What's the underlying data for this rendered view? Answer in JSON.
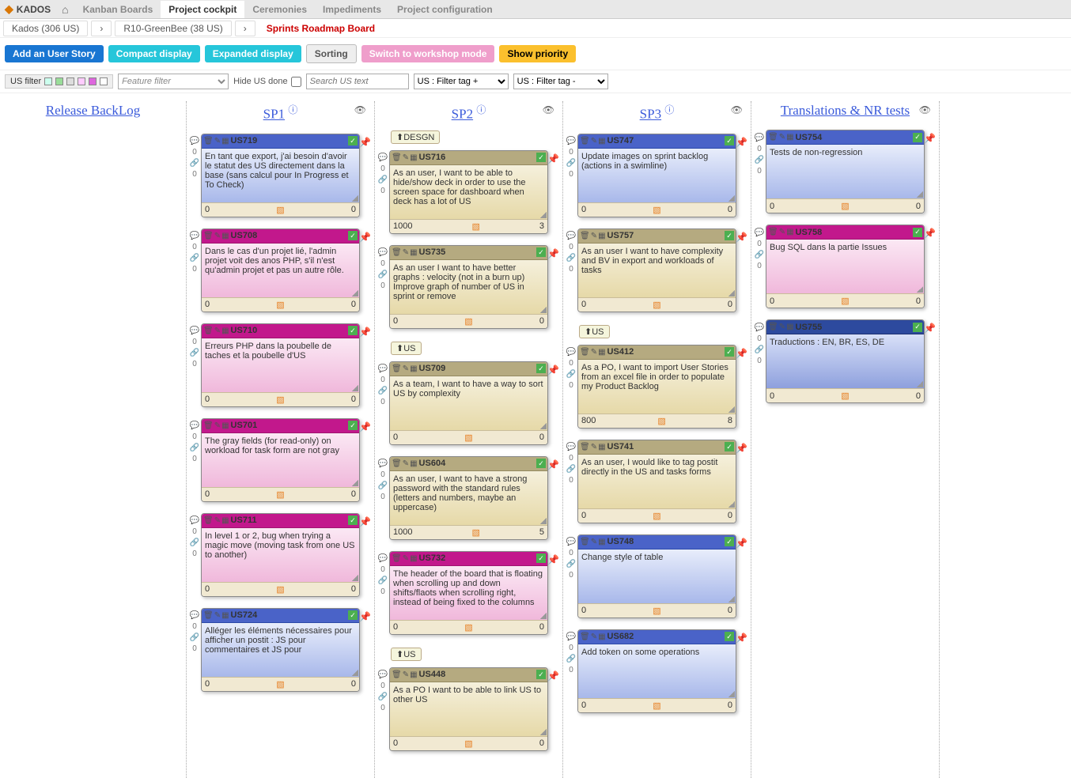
{
  "app": {
    "name": "KADOS"
  },
  "nav": {
    "home": "⌂",
    "items": [
      "Kanban Boards",
      "Project cockpit",
      "Ceremonies",
      "Impediments",
      "Project configuration"
    ],
    "active": 1
  },
  "breadcrumb": {
    "a": "Kados (306 US)",
    "b": "R10-GreenBee (38 US)",
    "c": "Sprints Roadmap Board"
  },
  "toolbar": {
    "add": "Add an User Story",
    "compact": "Compact display",
    "expanded": "Expanded display",
    "sorting": "Sorting",
    "workshop": "Switch to workshop mode",
    "priority": "Show priority"
  },
  "filters": {
    "uslabel": "US filter",
    "feature_ph": "Feature filter",
    "hidedone": "Hide US done",
    "search_ph": "Search US text",
    "tagplus": "US : Filter tag +",
    "tagminus": "US : Filter tag -"
  },
  "columns": {
    "backlog": "Release BackLog",
    "sp1": "SP1",
    "sp2": "SP2",
    "sp3": "SP3",
    "trans": "Translations & NR tests"
  },
  "groups": {
    "desgn": "DESGN",
    "us": "US"
  },
  "cards": {
    "sp1": [
      {
        "id": "US719",
        "txt": "En tant que export, j'ai besoin d'avoir le statut des US directement dans la base (sans calcul pour In Progress et To Check)",
        "l": "0",
        "r": "0",
        "c": "blue"
      },
      {
        "id": "US708",
        "txt": "Dans le cas d'un projet lié, l'admin projet voit des anos PHP, s'il n'est qu'admin projet et pas un autre rôle.",
        "l": "0",
        "r": "0",
        "c": "pink"
      },
      {
        "id": "US710",
        "txt": "Erreurs PHP dans la poubelle de taches et la poubelle d'US",
        "l": "0",
        "r": "0",
        "c": "pink"
      },
      {
        "id": "US701",
        "txt": "The gray fields (for read-only) on workload for task form are not gray",
        "l": "0",
        "r": "0",
        "c": "pink"
      },
      {
        "id": "US711",
        "txt": "In level 1 or 2, bug when trying a magic move (moving task from one US to another)",
        "l": "0",
        "r": "0",
        "c": "pink"
      },
      {
        "id": "US724",
        "txt": "Alléger les éléments nécessaires pour afficher un postit : JS pour commentaires et JS pour",
        "l": "0",
        "r": "0",
        "c": "blue"
      }
    ],
    "sp2": [
      {
        "id": "US716",
        "txt": "As an user, I want to be able to hide/show deck in order to use the screen space for dashboard when deck has a lot of US",
        "l": "1000",
        "r": "3",
        "c": "tan",
        "grp": "DESGN"
      },
      {
        "id": "US735",
        "txt": "As an user I want to have better graphs : velocity (not in a burn up)\nImprove graph of number of US in sprint or remove",
        "l": "0",
        "r": "0",
        "c": "tan"
      },
      {
        "id": "US709",
        "txt": "As a team, I want to have a way to sort US by complexity",
        "l": "0",
        "r": "0",
        "c": "tan",
        "grp": "US"
      },
      {
        "id": "US604",
        "txt": "As an user, I want to have a strong password with the standard rules (letters and numbers, maybe an uppercase)",
        "l": "1000",
        "r": "5",
        "c": "tan"
      },
      {
        "id": "US732",
        "txt": "The header of the board that is floating when scrolling up and down shifts/flaots when scrolling right, instead of being fixed to the columns",
        "l": "0",
        "r": "0",
        "c": "pink"
      },
      {
        "id": "US448",
        "txt": "As a PO I want to be able to link US to other US",
        "l": "0",
        "r": "0",
        "c": "tan",
        "grp": "US"
      }
    ],
    "sp3": [
      {
        "id": "US747",
        "txt": "Update images on sprint backlog (actions in a swimline)",
        "l": "0",
        "r": "0",
        "c": "blue"
      },
      {
        "id": "US757",
        "txt": "As an user I want to have complexity and BV in export and workloads of tasks",
        "l": "0",
        "r": "0",
        "c": "tan"
      },
      {
        "id": "US412",
        "txt": "As a PO, I want to import User Stories from an excel file in order to populate my Product Backlog",
        "l": "800",
        "r": "8",
        "c": "tan",
        "grp": "US"
      },
      {
        "id": "US741",
        "txt": "As an user, I would like to tag postit directly in the US and tasks forms",
        "l": "0",
        "r": "0",
        "c": "tan"
      },
      {
        "id": "US748",
        "txt": "Change style of table",
        "l": "0",
        "r": "0",
        "c": "blue"
      },
      {
        "id": "US682",
        "txt": "Add token on some operations",
        "l": "0",
        "r": "0",
        "c": "blue"
      }
    ],
    "trans": [
      {
        "id": "US754",
        "txt": "Tests de non-regression",
        "l": "0",
        "r": "0",
        "c": "blue"
      },
      {
        "id": "US758",
        "txt": "Bug SQL dans la partie Issues",
        "l": "0",
        "r": "0",
        "c": "pink"
      },
      {
        "id": "US755",
        "txt": "Traductions : EN, BR, ES, DE",
        "l": "0",
        "r": "0",
        "c": "dblue"
      }
    ]
  }
}
